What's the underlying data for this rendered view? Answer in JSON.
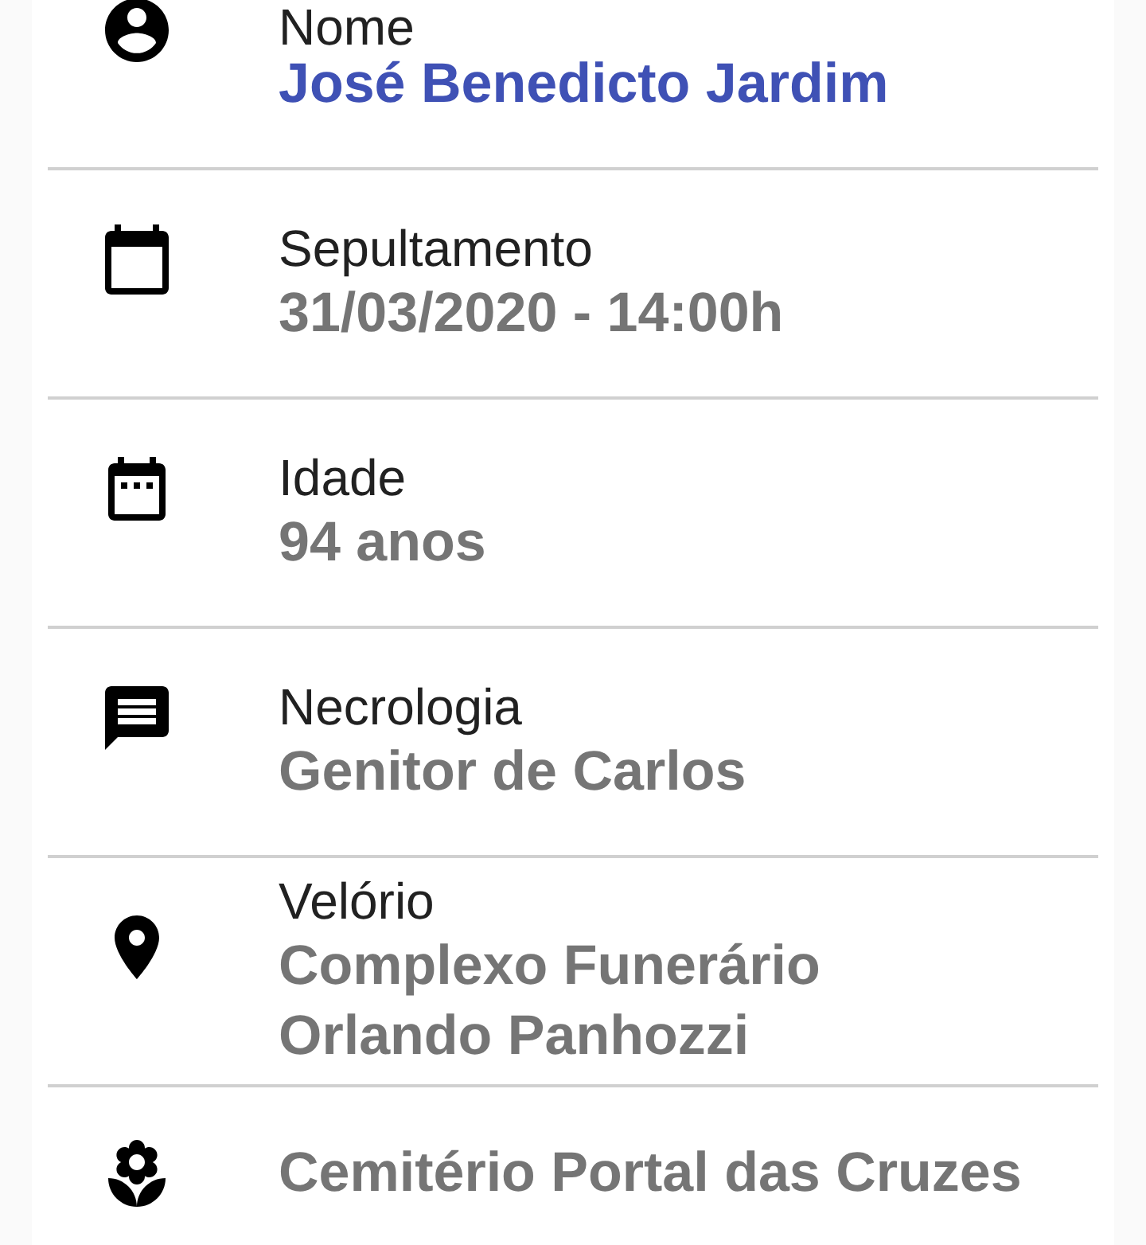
{
  "details": [
    {
      "kind": "name",
      "label": "Nome",
      "value": "José Benedicto Jardim"
    },
    {
      "kind": "burial",
      "label": "Sepultamento",
      "value": "31/03/2020 - 14:00h"
    },
    {
      "kind": "age",
      "label": "Idade",
      "value": "94 anos"
    },
    {
      "kind": "obituary",
      "label": "Necrologia",
      "value": "Genitor de Carlos"
    },
    {
      "kind": "wake",
      "label": "Velório",
      "value": "Complexo Funerário Orlando Panhozzi"
    },
    {
      "kind": "cemetery",
      "value": "Cemitério Portal das Cruzes"
    }
  ]
}
